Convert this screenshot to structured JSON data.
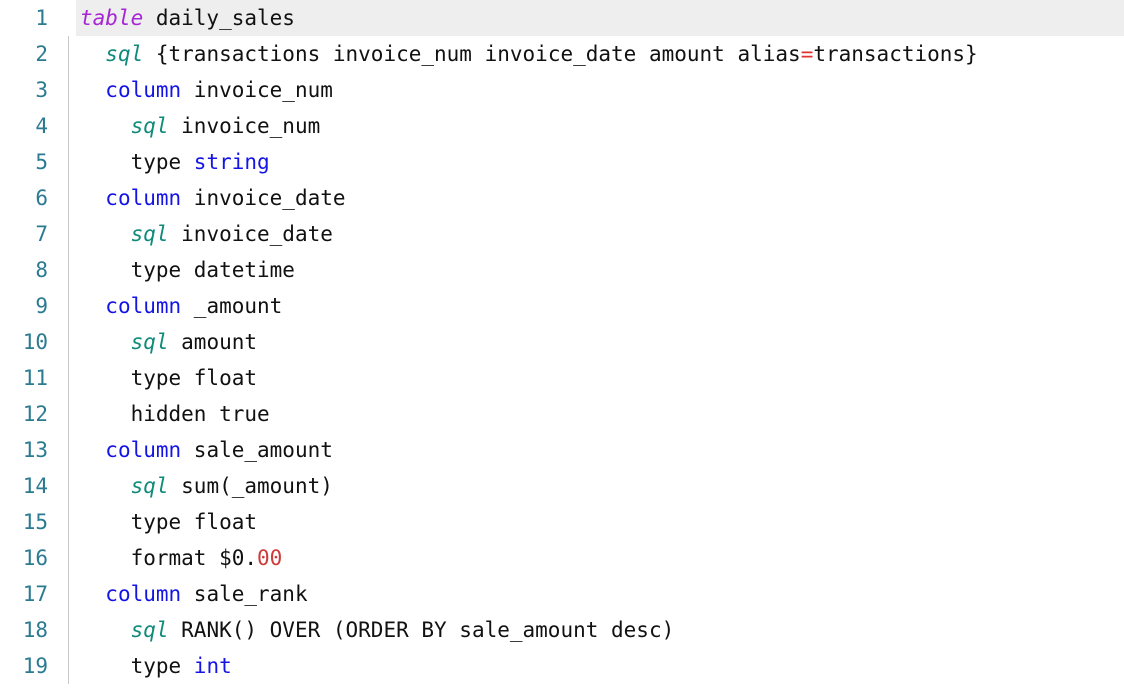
{
  "editor": {
    "language": "lookml",
    "file_title": "daily_sales",
    "active_line": 1,
    "first_line": 1,
    "last_line": 19,
    "colors": {
      "background": "#ffffff",
      "active_line_background": "#eeeeee",
      "gutter_text": "#2a7a90",
      "divider": "#c8c8c8",
      "text": "#111111",
      "keyword_table": "#a626d4",
      "keyword_sql": "#108a7a",
      "keyword_column": "#1414e6",
      "type_literal": "#1414e6",
      "operator": "#e03030",
      "number": "#d03a3a"
    }
  },
  "lines": [
    {
      "number": "1",
      "active": true,
      "indent": 0,
      "text": "table daily_sales",
      "tokens": [
        {
          "text": "table",
          "kind": "table"
        },
        {
          "text": " daily_sales",
          "kind": "plain"
        }
      ]
    },
    {
      "number": "2",
      "active": false,
      "indent": 2,
      "text": "sql {transactions invoice_num invoice_date amount alias=transactions}",
      "tokens": [
        {
          "text": "sql",
          "kind": "sql"
        },
        {
          "text": " {transactions invoice_num invoice_date amount alias",
          "kind": "plain"
        },
        {
          "text": "=",
          "kind": "op"
        },
        {
          "text": "transactions}",
          "kind": "plain"
        }
      ]
    },
    {
      "number": "3",
      "active": false,
      "indent": 2,
      "text": "column invoice_num",
      "tokens": [
        {
          "text": "column",
          "kind": "column"
        },
        {
          "text": " invoice_num",
          "kind": "plain"
        }
      ]
    },
    {
      "number": "4",
      "active": false,
      "indent": 4,
      "text": "sql invoice_num",
      "tokens": [
        {
          "text": "sql",
          "kind": "sql"
        },
        {
          "text": " invoice_num",
          "kind": "plain"
        }
      ]
    },
    {
      "number": "5",
      "active": false,
      "indent": 4,
      "text": "type string",
      "tokens": [
        {
          "text": "type ",
          "kind": "plain"
        },
        {
          "text": "string",
          "kind": "type"
        }
      ]
    },
    {
      "number": "6",
      "active": false,
      "indent": 2,
      "text": "column invoice_date",
      "tokens": [
        {
          "text": "column",
          "kind": "column"
        },
        {
          "text": " invoice_date",
          "kind": "plain"
        }
      ]
    },
    {
      "number": "7",
      "active": false,
      "indent": 4,
      "text": "sql invoice_date",
      "tokens": [
        {
          "text": "sql",
          "kind": "sql"
        },
        {
          "text": " invoice_date",
          "kind": "plain"
        }
      ]
    },
    {
      "number": "8",
      "active": false,
      "indent": 4,
      "text": "type datetime",
      "tokens": [
        {
          "text": "type datetime",
          "kind": "plain"
        }
      ]
    },
    {
      "number": "9",
      "active": false,
      "indent": 2,
      "text": "column _amount",
      "tokens": [
        {
          "text": "column",
          "kind": "column"
        },
        {
          "text": " _amount",
          "kind": "plain"
        }
      ]
    },
    {
      "number": "10",
      "active": false,
      "indent": 4,
      "text": "sql amount",
      "tokens": [
        {
          "text": "sql",
          "kind": "sql"
        },
        {
          "text": " amount",
          "kind": "plain"
        }
      ]
    },
    {
      "number": "11",
      "active": false,
      "indent": 4,
      "text": "type float",
      "tokens": [
        {
          "text": "type float",
          "kind": "plain"
        }
      ]
    },
    {
      "number": "12",
      "active": false,
      "indent": 4,
      "text": "hidden true",
      "tokens": [
        {
          "text": "hidden true",
          "kind": "plain"
        }
      ]
    },
    {
      "number": "13",
      "active": false,
      "indent": 2,
      "text": "column sale_amount",
      "tokens": [
        {
          "text": "column",
          "kind": "column"
        },
        {
          "text": " sale_amount",
          "kind": "plain"
        }
      ]
    },
    {
      "number": "14",
      "active": false,
      "indent": 4,
      "text": "sql sum(_amount)",
      "tokens": [
        {
          "text": "sql",
          "kind": "sql"
        },
        {
          "text": " sum(_amount)",
          "kind": "plain"
        }
      ]
    },
    {
      "number": "15",
      "active": false,
      "indent": 4,
      "text": "type float",
      "tokens": [
        {
          "text": "type float",
          "kind": "plain"
        }
      ]
    },
    {
      "number": "16",
      "active": false,
      "indent": 4,
      "text": "format $0.00",
      "tokens": [
        {
          "text": "format $0.",
          "kind": "plain"
        },
        {
          "text": "00",
          "kind": "num"
        }
      ]
    },
    {
      "number": "17",
      "active": false,
      "indent": 2,
      "text": "column sale_rank",
      "tokens": [
        {
          "text": "column",
          "kind": "column"
        },
        {
          "text": " sale_rank",
          "kind": "plain"
        }
      ]
    },
    {
      "number": "18",
      "active": false,
      "indent": 4,
      "text": "sql RANK() OVER (ORDER BY sale_amount desc)",
      "tokens": [
        {
          "text": "sql",
          "kind": "sql"
        },
        {
          "text": " RANK() OVER (ORDER BY sale_amount desc)",
          "kind": "plain"
        }
      ]
    },
    {
      "number": "19",
      "active": false,
      "indent": 4,
      "text": "type int",
      "tokens": [
        {
          "text": "type ",
          "kind": "plain"
        },
        {
          "text": "int",
          "kind": "type"
        }
      ]
    }
  ]
}
